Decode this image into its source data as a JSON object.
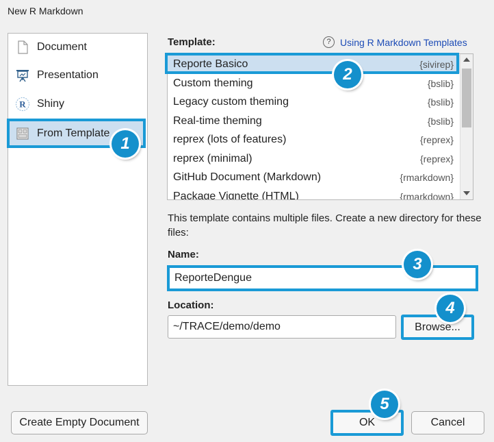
{
  "window": {
    "title": "New R Markdown"
  },
  "sidebar": {
    "items": [
      {
        "label": "Document",
        "icon": "document-icon",
        "selected": false
      },
      {
        "label": "Presentation",
        "icon": "presentation-icon",
        "selected": false
      },
      {
        "label": "Shiny",
        "icon": "shiny-r-icon",
        "selected": false
      },
      {
        "label": "From Template",
        "icon": "template-icon",
        "selected": true
      }
    ]
  },
  "template_section": {
    "label": "Template:",
    "help_icon": "?",
    "help_link": "Using R Markdown Templates",
    "items": [
      {
        "name": "Reporte Basico",
        "package": "{sivirep}",
        "selected": true
      },
      {
        "name": "Custom theming",
        "package": "{bslib}"
      },
      {
        "name": "Legacy custom theming",
        "package": "{bslib}"
      },
      {
        "name": "Real-time theming",
        "package": "{bslib}"
      },
      {
        "name": "reprex (lots of features)",
        "package": "{reprex}"
      },
      {
        "name": "reprex (minimal)",
        "package": "{reprex}"
      },
      {
        "name": "GitHub Document (Markdown)",
        "package": "{rmarkdown}"
      },
      {
        "name": "Package Vignette (HTML)",
        "package": "{rmarkdown}"
      }
    ]
  },
  "description": "This template contains multiple files. Create a new directory for these files:",
  "name_field": {
    "label": "Name:",
    "value": "ReporteDengue"
  },
  "location_field": {
    "label": "Location:",
    "value": "~/TRACE/demo/demo"
  },
  "buttons": {
    "browse": "Browse...",
    "create_empty": "Create Empty Document",
    "ok": "OK",
    "cancel": "Cancel"
  },
  "callouts": [
    "1",
    "2",
    "3",
    "4",
    "5"
  ],
  "colors": {
    "highlight": "#1a9ad6",
    "selection": "#ccdff0",
    "badge": "#1490cc",
    "link": "#1c4bb6"
  }
}
